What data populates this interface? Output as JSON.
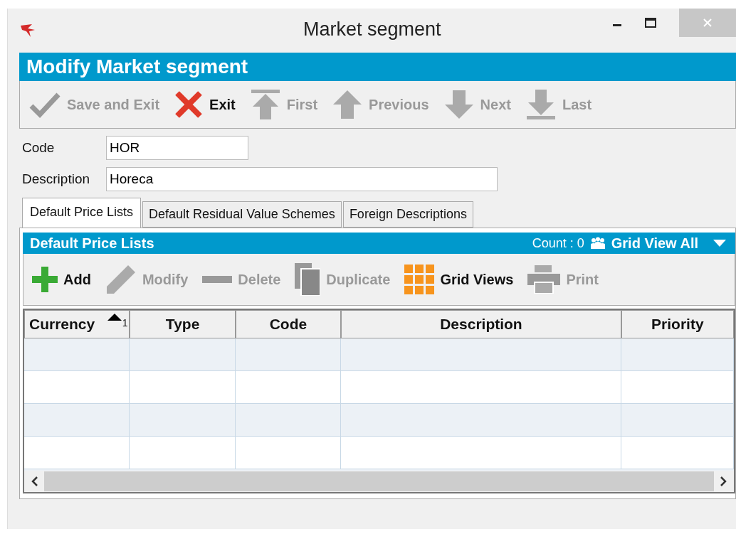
{
  "window": {
    "title": "Market segment"
  },
  "header": {
    "title": "Modify Market segment"
  },
  "toolbar": [
    {
      "kind": "check",
      "label": "Save and Exit",
      "disabled": true
    },
    {
      "kind": "cross",
      "label": "Exit",
      "disabled": false
    },
    {
      "kind": "first",
      "label": "First",
      "disabled": true
    },
    {
      "kind": "up",
      "label": "Previous",
      "disabled": true
    },
    {
      "kind": "down",
      "label": "Next",
      "disabled": true
    },
    {
      "kind": "last",
      "label": "Last",
      "disabled": true
    }
  ],
  "fields": [
    {
      "label": "Code",
      "value": "HOR"
    },
    {
      "label": "Description",
      "value": "Horeca"
    }
  ],
  "tabs": [
    {
      "label": "Default Price Lists",
      "selected": true
    },
    {
      "label": "Default Residual Value Schemes",
      "selected": false
    },
    {
      "label": "Foreign Descriptions",
      "selected": false
    }
  ],
  "panel": {
    "title": "Default Price Lists",
    "count": "Count : 0",
    "grid_view": "Grid View All"
  },
  "grid_toolbar": [
    {
      "kind": "plus",
      "label": "Add",
      "disabled": false
    },
    {
      "kind": "pencil",
      "label": "Modify",
      "disabled": true
    },
    {
      "kind": "minus",
      "label": "Delete",
      "disabled": true
    },
    {
      "kind": "copy",
      "label": "Duplicate",
      "disabled": true
    },
    {
      "kind": "grid",
      "label": "Grid Views",
      "disabled": false
    },
    {
      "kind": "printer",
      "label": "Print",
      "disabled": true
    }
  ],
  "table": {
    "columns": [
      {
        "label": "Currency",
        "sort": "1"
      },
      {
        "label": "Type"
      },
      {
        "label": "Code"
      },
      {
        "label": "Description"
      },
      {
        "label": "Priority"
      }
    ]
  }
}
